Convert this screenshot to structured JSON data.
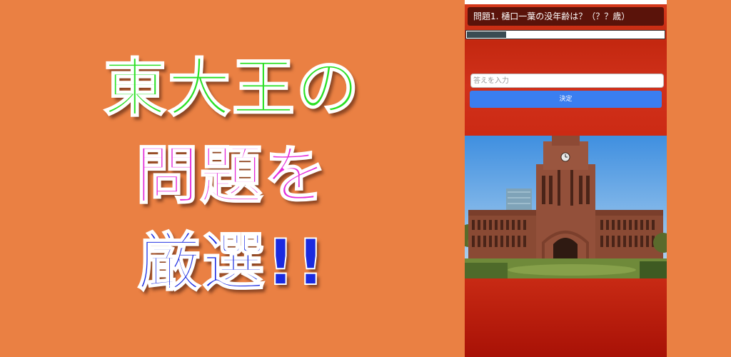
{
  "promo": {
    "line1": "東大王の",
    "line2": "問題を",
    "line3": "厳選!!",
    "colors": {
      "line1": "#2adf22",
      "line2": "#e32bd8",
      "line3": "#1a2ae0",
      "background": "#ea8043"
    }
  },
  "app": {
    "question": "問題1. 樋口一葉の没年齢は？（？？歳）",
    "progress_fraction": 0.2,
    "answer_placeholder": "答えを入力",
    "answer_value": "",
    "submit_label": "決定",
    "photo_icon": "university-clock-tower-image",
    "colors": {
      "question_bar": "#5a130a",
      "submit_button": "#3a7ef0",
      "panel": "#cc2a14"
    }
  }
}
